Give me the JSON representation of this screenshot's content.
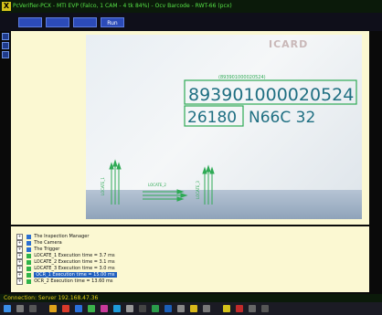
{
  "window": {
    "title": "PcVerifier-PCX - MTI EVP (Falco, 1 CAM - 4 tk 84%) - Ocv Barcode - RWT-66 (pcx)"
  },
  "toolbar": {
    "buttons": [
      "",
      "",
      "",
      "Run"
    ]
  },
  "image": {
    "faint_label": "ICARD",
    "barcode_text": "893901000020524",
    "small_label": "(893901000020524)",
    "code_text": "26180",
    "code_suffix": "N66C 32",
    "edge_labels": [
      "LOCATE_1",
      "LOCATE_2",
      "LOCATE_3"
    ]
  },
  "tree": {
    "items": [
      {
        "label": "The Inspection Manager",
        "indent": 0,
        "icon": "manager-icon",
        "selected": false
      },
      {
        "label": "The Camera",
        "indent": 0,
        "icon": "camera-icon",
        "selected": false
      },
      {
        "label": "The Trigger",
        "indent": 0,
        "icon": "trigger-icon",
        "selected": false
      },
      {
        "label": "LOCATE_1 Execution time = 3.7 ms",
        "indent": 0,
        "icon": "check-icon",
        "selected": false
      },
      {
        "label": "LOCATE_2 Execution time = 3.1 ms",
        "indent": 0,
        "icon": "check-icon",
        "selected": false
      },
      {
        "label": "LOCATE_3 Execution time = 3.0 ms",
        "indent": 0,
        "icon": "check-icon",
        "selected": false
      },
      {
        "label": "OCR_1 Execution time = 15.00 ms",
        "indent": 0,
        "icon": "check-icon",
        "selected": true
      },
      {
        "label": "OCR_2 Execution time = 13.60 ms",
        "indent": 0,
        "icon": "check-icon",
        "selected": false
      }
    ]
  },
  "status": {
    "text": "Connection: Server 192.168.47.36"
  },
  "colors": {
    "overlay": "#2faa55",
    "panel": "#fbf8d2",
    "selection": "#1f5fbf"
  }
}
